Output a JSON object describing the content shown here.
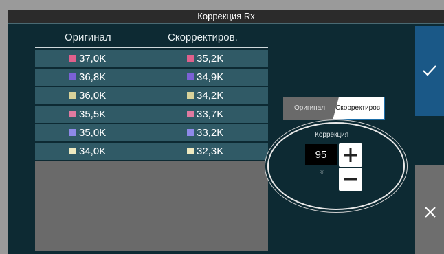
{
  "title": "Коррекция Rx",
  "columns": {
    "original": "Оригинал",
    "corrected": "Скорректиров."
  },
  "rows": [
    {
      "orig": "37,0K",
      "corr": "35,2K",
      "color": "#e0608c"
    },
    {
      "orig": "36,8K",
      "corr": "34,9K",
      "color": "#7b61d6"
    },
    {
      "orig": "36,0K",
      "corr": "34,2K",
      "color": "#d8d29a"
    },
    {
      "orig": "35,5K",
      "corr": "33,7K",
      "color": "#e07aa0"
    },
    {
      "orig": "35,0K",
      "corr": "33,2K",
      "color": "#8e89e8"
    },
    {
      "orig": "34,0K",
      "corr": "32,3K",
      "color": "#eee9c0"
    }
  ],
  "toggle": {
    "left": "Оригинал",
    "right": "Скорректиров.",
    "selected": "right"
  },
  "correction": {
    "label": "Коррекция",
    "value": "95",
    "unit": "%"
  },
  "icons": {
    "ok": "check-icon",
    "cancel": "close-icon",
    "plus": "plus-icon",
    "minus": "minus-icon"
  },
  "colors": {
    "background": "#0d2a33",
    "row": "#305a66",
    "ok_button": "#1a5887",
    "cancel_button": "#6e6e6e"
  }
}
